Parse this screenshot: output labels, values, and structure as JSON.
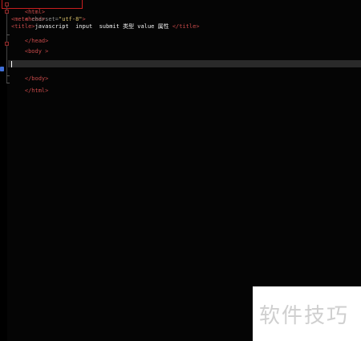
{
  "editor": {
    "lines": {
      "html_open": "<html>",
      "head_open": "<head>",
      "meta_tag_open": "<meta ",
      "meta_attr_name": "charset=",
      "meta_attr_value": "\"utf-8\"",
      "meta_tag_close": ">",
      "title_open": "<title>",
      "title_text": "javascript  input  submit 类型 value 属性 ",
      "title_close": "</title>",
      "head_close": "</head>",
      "body_open": "<body >",
      "body_close": "</body>",
      "html_close": "</html>"
    },
    "colors": {
      "background": "#050505",
      "tag": "#c84a4a",
      "attribute": "#8a8a8a",
      "string": "#d8c06a",
      "text": "#f0f0f0",
      "current_line": "#2a2a2a"
    }
  },
  "watermark": {
    "text": "软件技巧"
  }
}
